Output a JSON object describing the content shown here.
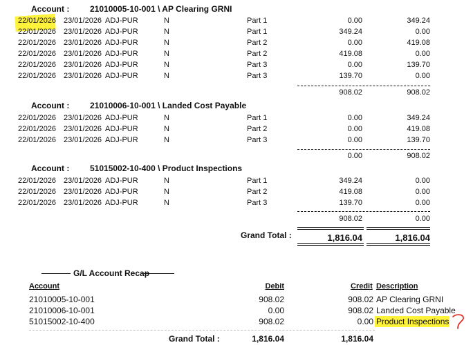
{
  "colors": {
    "highlight": "#fff23a",
    "annotation": "#e0302a",
    "text": "#111111"
  },
  "sections": [
    {
      "label": "Account :",
      "account": "21010005-10-001 \\ AP Clearing GRNI",
      "rows": [
        {
          "date1": "22/01/2026",
          "date2": "23/01/2026",
          "source": "ADJ-PUR",
          "flag": "N",
          "part": "Part 1",
          "debit": "0.00",
          "credit": "349.24"
        },
        {
          "date1": "22/01/2026",
          "date2": "23/01/2026",
          "source": "ADJ-PUR",
          "flag": "N",
          "part": "Part 1",
          "debit": "349.24",
          "credit": "0.00"
        },
        {
          "date1": "22/01/2026",
          "date2": "23/01/2026",
          "source": "ADJ-PUR",
          "flag": "N",
          "part": "Part 2",
          "debit": "0.00",
          "credit": "419.08"
        },
        {
          "date1": "22/01/2026",
          "date2": "23/01/2026",
          "source": "ADJ-PUR",
          "flag": "N",
          "part": "Part 2",
          "debit": "419.08",
          "credit": "0.00"
        },
        {
          "date1": "22/01/2026",
          "date2": "23/01/2026",
          "source": "ADJ-PUR",
          "flag": "N",
          "part": "Part 3",
          "debit": "0.00",
          "credit": "139.70"
        },
        {
          "date1": "22/01/2026",
          "date2": "23/01/2026",
          "source": "ADJ-PUR",
          "flag": "N",
          "part": "Part 3",
          "debit": "139.70",
          "credit": "0.00"
        }
      ],
      "total_debit": "908.02",
      "total_credit": "908.02"
    },
    {
      "label": "Account :",
      "account": "21010006-10-001 \\ Landed Cost Payable",
      "rows": [
        {
          "date1": "22/01/2026",
          "date2": "23/01/2026",
          "source": "ADJ-PUR",
          "flag": "N",
          "part": "Part 1",
          "debit": "0.00",
          "credit": "349.24"
        },
        {
          "date1": "22/01/2026",
          "date2": "23/01/2026",
          "source": "ADJ-PUR",
          "flag": "N",
          "part": "Part 2",
          "debit": "0.00",
          "credit": "419.08"
        },
        {
          "date1": "22/01/2026",
          "date2": "23/01/2026",
          "source": "ADJ-PUR",
          "flag": "N",
          "part": "Part 3",
          "debit": "0.00",
          "credit": "139.70"
        }
      ],
      "total_debit": "0.00",
      "total_credit": "908.02"
    },
    {
      "label": "Account :",
      "account": "51015002-10-400 \\ Product Inspections",
      "rows": [
        {
          "date1": "22/01/2026",
          "date2": "23/01/2026",
          "source": "ADJ-PUR",
          "flag": "N",
          "part": "Part 1",
          "debit": "349.24",
          "credit": "0.00"
        },
        {
          "date1": "22/01/2026",
          "date2": "23/01/2026",
          "source": "ADJ-PUR",
          "flag": "N",
          "part": "Part 2",
          "debit": "419.08",
          "credit": "0.00"
        },
        {
          "date1": "22/01/2026",
          "date2": "23/01/2026",
          "source": "ADJ-PUR",
          "flag": "N",
          "part": "Part 3",
          "debit": "139.70",
          "credit": "0.00"
        }
      ],
      "total_debit": "908.02",
      "total_credit": "0.00"
    }
  ],
  "grand_total": {
    "label": "Grand Total :",
    "debit": "1,816.04",
    "credit": "1,816.04"
  },
  "recap": {
    "title": "G/L Account Recap",
    "headers": {
      "account": "Account",
      "debit": "Debit",
      "credit": "Credit",
      "description": "Description"
    },
    "rows": [
      {
        "account": "21010005-10-001",
        "debit": "908.02",
        "credit": "908.02",
        "description": "AP Clearing GRNI"
      },
      {
        "account": "21010006-10-001",
        "debit": "0.00",
        "credit": "908.02",
        "description": "Landed Cost Payable"
      },
      {
        "account": "51015002-10-400",
        "debit": "908.02",
        "credit": "0.00",
        "description": "Product Inspections"
      }
    ],
    "grand_total_label": "Grand Total :",
    "grand_total_debit": "1,816.04",
    "grand_total_credit": "1,816.04"
  },
  "annotation": "?"
}
